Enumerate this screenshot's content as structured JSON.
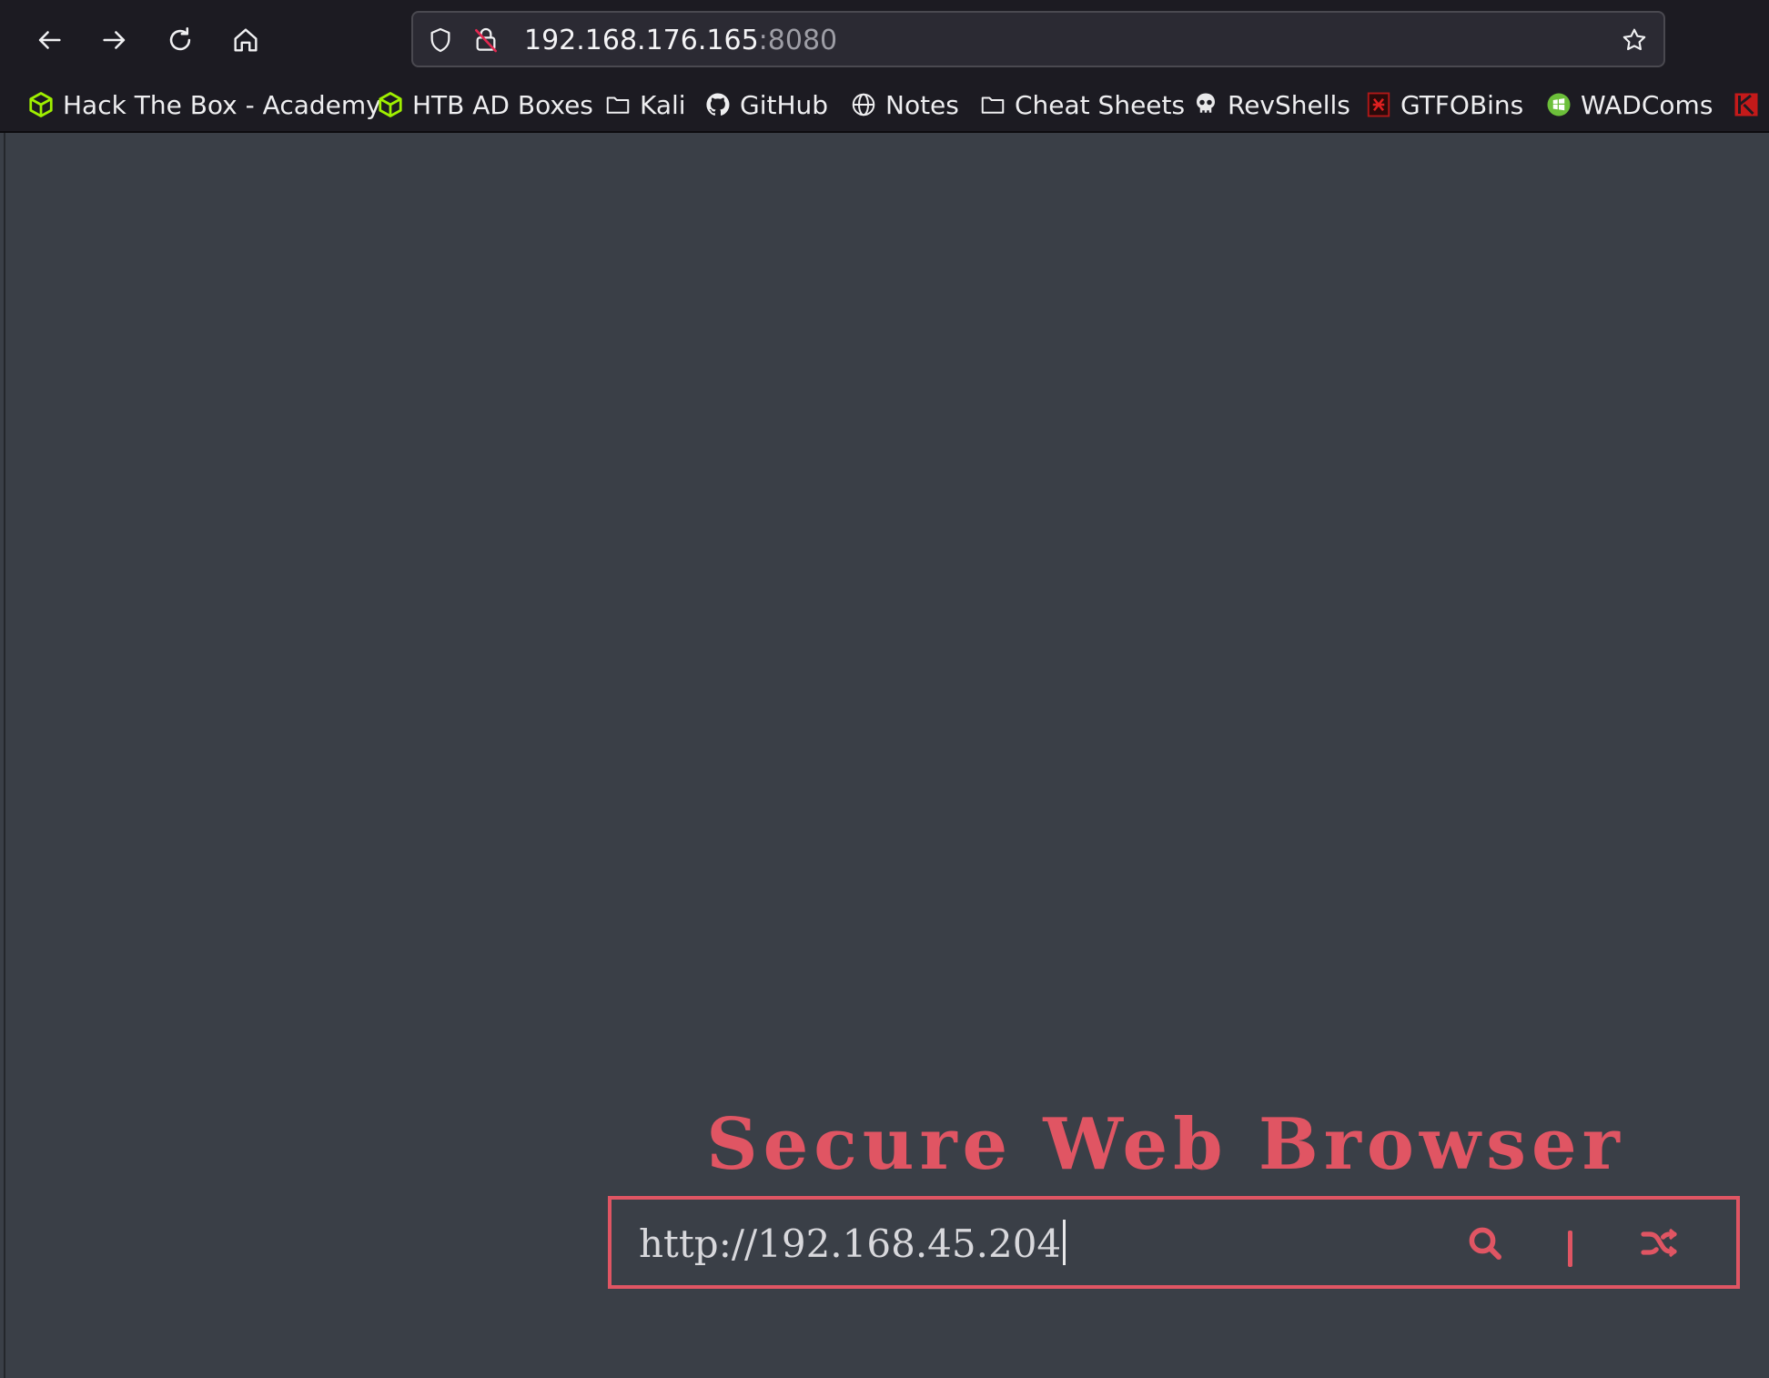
{
  "browser": {
    "url_host": "192.168.176.165",
    "url_port": ":8080",
    "nav": {
      "back_icon": "arrow-left-icon",
      "forward_icon": "arrow-right-icon",
      "reload_icon": "reload-icon",
      "home_icon": "home-icon"
    },
    "bookmarks": [
      {
        "label": "Hack The Box - Academy",
        "icon": "htb-cube-icon"
      },
      {
        "label": "HTB AD Boxes",
        "icon": "htb-cube-icon"
      },
      {
        "label": "Kali",
        "icon": "folder-icon"
      },
      {
        "label": "GitHub",
        "icon": "github-icon"
      },
      {
        "label": "Notes",
        "icon": "globe-icon"
      },
      {
        "label": "Cheat Sheets",
        "icon": "folder-icon"
      },
      {
        "label": "RevShells",
        "icon": "skull-icon"
      },
      {
        "label": "GTFOBins",
        "icon": "gtfobins-icon"
      },
      {
        "label": "WADComs",
        "icon": "wadcoms-icon"
      }
    ]
  },
  "page": {
    "title": "Secure Web Browser",
    "search_value": "http://192.168.45.204",
    "accent_color": "#e05563",
    "background_color": "#3a3f47",
    "icons": {
      "search": "search-icon",
      "divider": "divider",
      "random": "shuffle-icon"
    }
  }
}
